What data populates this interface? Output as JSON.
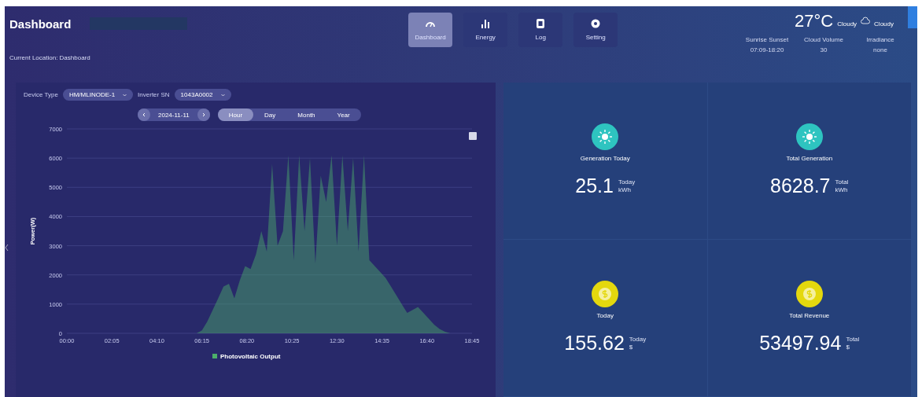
{
  "header": {
    "title": "Dashboard",
    "breadcrumb": "Current Location: Dashboard"
  },
  "nav": [
    {
      "label": "Dashboard",
      "kind": "gauge",
      "selected": true
    },
    {
      "label": "Energy",
      "kind": "bars",
      "selected": false
    },
    {
      "label": "Log",
      "kind": "square",
      "selected": false
    },
    {
      "label": "Setting",
      "kind": "gear",
      "selected": false
    }
  ],
  "weather": {
    "temperature": "27°C",
    "condition": "Cloudy",
    "condition_2": "Cloudy",
    "stats": [
      {
        "label": "Sunrise Sunset",
        "value": "07:09-18:20"
      },
      {
        "label": "Cloud Volume",
        "value": "30"
      },
      {
        "label": "Irradiance",
        "value": "none"
      }
    ]
  },
  "filters": [
    {
      "label": "Device Type",
      "value": "HM/MLINODE-1"
    },
    {
      "label": "Inverter SN",
      "value": "1043A0002"
    }
  ],
  "date": "2024-11-11",
  "periods": [
    {
      "label": "Hour",
      "selected": true
    },
    {
      "label": "Day",
      "selected": false
    },
    {
      "label": "Month",
      "selected": false
    },
    {
      "label": "Year",
      "selected": false
    }
  ],
  "chart_data": {
    "type": "area",
    "ylabel": "Power(W)",
    "x": [
      0,
      360,
      375,
      390,
      405,
      420,
      435,
      450,
      465,
      480,
      495,
      510,
      525,
      540,
      555,
      570,
      585,
      600,
      615,
      630,
      645,
      660,
      675,
      690,
      705,
      720,
      735,
      750,
      765,
      780,
      795,
      810,
      825,
      840,
      855,
      870,
      885,
      900,
      915,
      930,
      945,
      960,
      975,
      990,
      1005,
      1020,
      1035,
      1050,
      1065,
      1125
    ],
    "series": [
      {
        "name": "Photovoltaic Output",
        "color": "#4caf6a",
        "values": [
          0,
          0,
          100,
          400,
          800,
          1200,
          1600,
          1700,
          1200,
          1800,
          2300,
          2200,
          2700,
          3500,
          2800,
          5800,
          3000,
          3500,
          6100,
          2500,
          6100,
          3500,
          6000,
          2400,
          5400,
          4500,
          6100,
          3000,
          6100,
          3500,
          6000,
          2800,
          6100,
          2500,
          2300,
          2100,
          1900,
          1600,
          1300,
          1000,
          700,
          800,
          900,
          700,
          500,
          300,
          150,
          50,
          0,
          0
        ]
      }
    ],
    "xlim": [
      0,
      1125
    ],
    "ylim": [
      0,
      7000
    ],
    "xticks": [
      {
        "value": 0,
        "label": "00:00"
      },
      {
        "value": 125,
        "label": "02:05"
      },
      {
        "value": 250,
        "label": "04:10"
      },
      {
        "value": 375,
        "label": "06:15"
      },
      {
        "value": 500,
        "label": "08:20"
      },
      {
        "value": 625,
        "label": "10:25"
      },
      {
        "value": 750,
        "label": "12:30"
      },
      {
        "value": 875,
        "label": "14:35"
      },
      {
        "value": 1000,
        "label": "16:40"
      },
      {
        "value": 1125,
        "label": "18:45"
      }
    ],
    "yticks": [
      0,
      1000,
      2000,
      3000,
      4000,
      5000,
      6000,
      7000
    ],
    "grid": true
  },
  "stats": [
    {
      "kind": "energy",
      "color": "#2ec4c0",
      "label": "Generation Today",
      "value": "25.1",
      "period": "Today",
      "unit": "kWh"
    },
    {
      "kind": "energy",
      "color": "#2ec4c0",
      "label": "Total Generation",
      "value": "8628.7",
      "period": "Total",
      "unit": "kWh"
    },
    {
      "kind": "money",
      "color": "#e4d80e",
      "label": "Today",
      "value": "155.62",
      "period": "Today",
      "unit": "$"
    },
    {
      "kind": "money",
      "color": "#e4d80e",
      "label": "Total Revenue",
      "value": "53497.94",
      "period": "Total",
      "unit": "$"
    }
  ]
}
